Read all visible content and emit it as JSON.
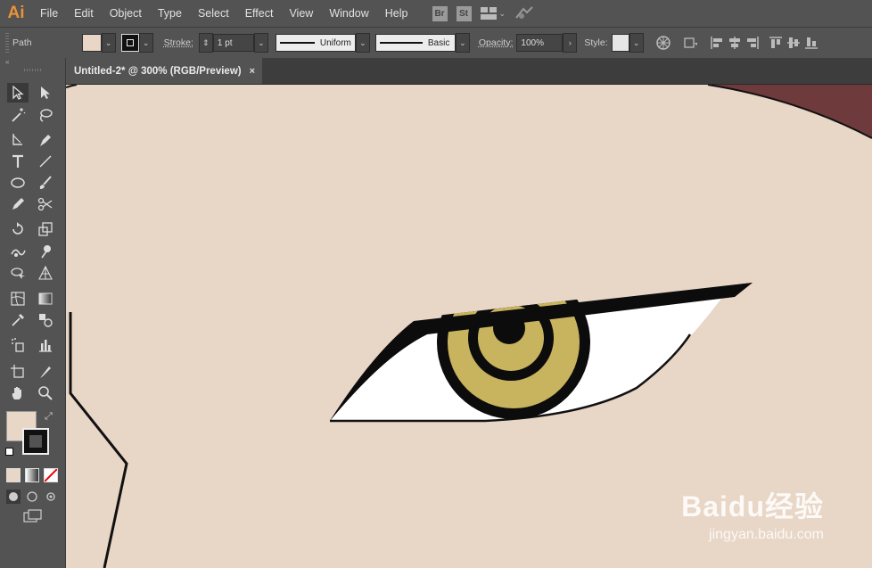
{
  "app": {
    "logo": "Ai"
  },
  "menu": [
    "File",
    "Edit",
    "Object",
    "Type",
    "Select",
    "Effect",
    "View",
    "Window",
    "Help"
  ],
  "menu_icons": {
    "bridge": "Br",
    "stock": "St"
  },
  "control_bar": {
    "selection_label": "Path",
    "stroke_label": "Stroke:",
    "stroke_weight": "1 pt",
    "profile": "Uniform",
    "brush": "Basic",
    "opacity_label": "Opacity:",
    "opacity_value": "100%",
    "style_label": "Style:"
  },
  "document_tab": {
    "title": "Untitled-2* @ 300% (RGB/Preview)",
    "close": "×"
  },
  "colors": {
    "fill": "#e8d6c7",
    "stroke": "#111111",
    "iris": "#c8b35e",
    "hair": "#6e3a3c"
  },
  "watermark": {
    "brand": "Baidu经验",
    "url": "jingyan.baidu.com"
  }
}
